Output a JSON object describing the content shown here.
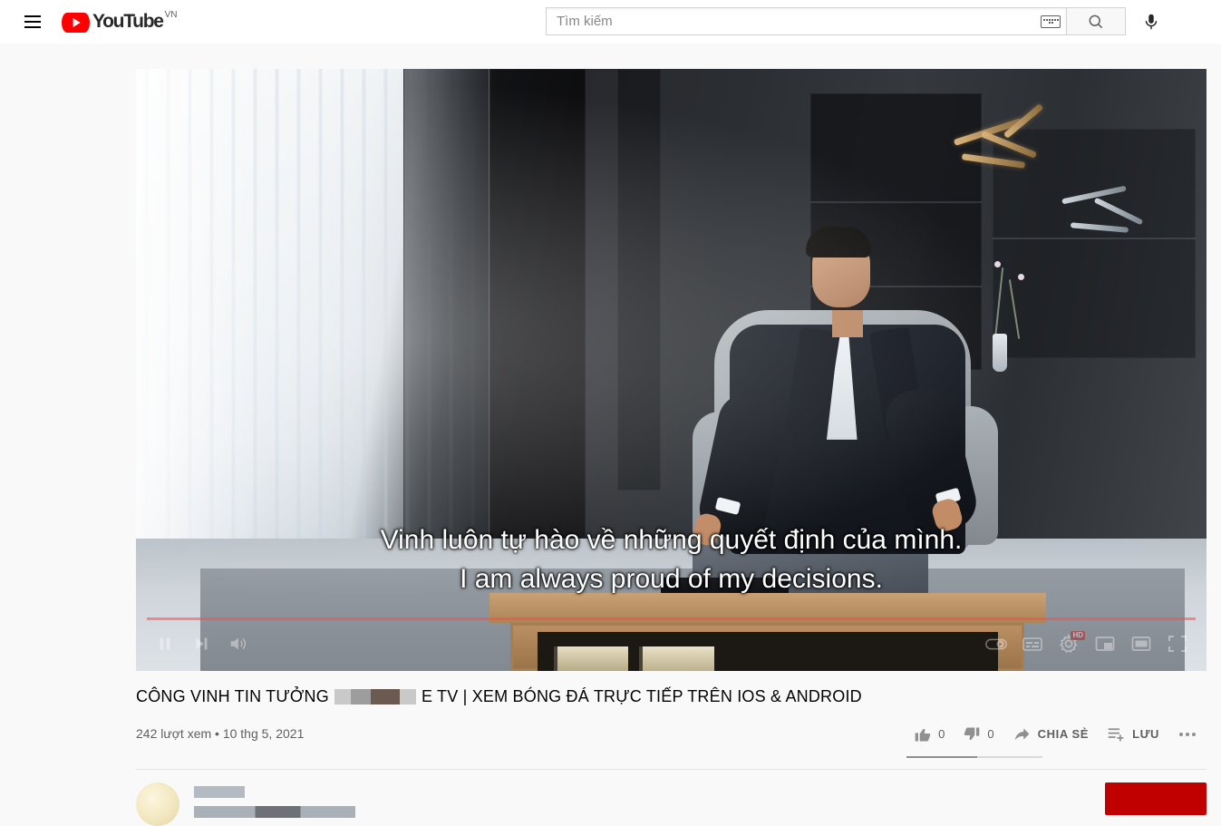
{
  "app": {
    "name": "YouTube",
    "country_code": "VN",
    "brand_red": "#ff0000",
    "page_background": "#f9f9f9"
  },
  "masthead": {
    "menu_icon": "hamburger-icon",
    "logo_text": "YouTube",
    "logo_country": "VN",
    "search": {
      "placeholder": "Tìm kiếm",
      "value": "",
      "keyboard_icon": "keyboard-icon",
      "search_icon": "search-icon",
      "search_button_label": "Tìm kiếm"
    },
    "voice_search_icon": "microphone-icon"
  },
  "player": {
    "state": "playing",
    "progress_percent": 100,
    "quality_badge": "HD",
    "captions": {
      "line1": "Vinh luôn tự hào về những quyết định của mình.",
      "line2": "I am always proud of my decisions."
    },
    "controls": {
      "pause_icon": "pause-icon",
      "next_icon": "next-video-icon",
      "volume_icon": "volume-icon",
      "autoplay_icon": "autoplay-toggle-icon",
      "subtitles_icon": "subtitles-icon",
      "settings_icon": "settings-gear-icon",
      "miniplayer_icon": "miniplayer-icon",
      "theater_icon": "theater-mode-icon",
      "fullscreen_icon": "fullscreen-icon"
    }
  },
  "video": {
    "title_before": "CÔNG VINH TIN TƯỞNG",
    "title_after": "E TV | XEM BÓNG ĐÁ TRỰC TIẾP TRÊN IOS & ANDROID",
    "title_redacted": true,
    "views": "242 lượt xem",
    "separator": "•",
    "published": "10 thg 5, 2021"
  },
  "actions": {
    "like": {
      "label": "",
      "count": "0",
      "icon": "thumbs-up-icon"
    },
    "dislike": {
      "label": "",
      "count": "0",
      "icon": "thumbs-down-icon"
    },
    "share": {
      "label": "CHIA SẺ",
      "icon": "share-arrow-icon"
    },
    "save": {
      "label": "LƯU",
      "icon": "save-to-playlist-icon"
    },
    "more": {
      "label": "",
      "icon": "more-actions-icon"
    }
  },
  "channel": {
    "avatar_icon": "channel-avatar",
    "name_redacted": true,
    "subscribe_button": {
      "label": "",
      "color": "#c00000"
    }
  }
}
